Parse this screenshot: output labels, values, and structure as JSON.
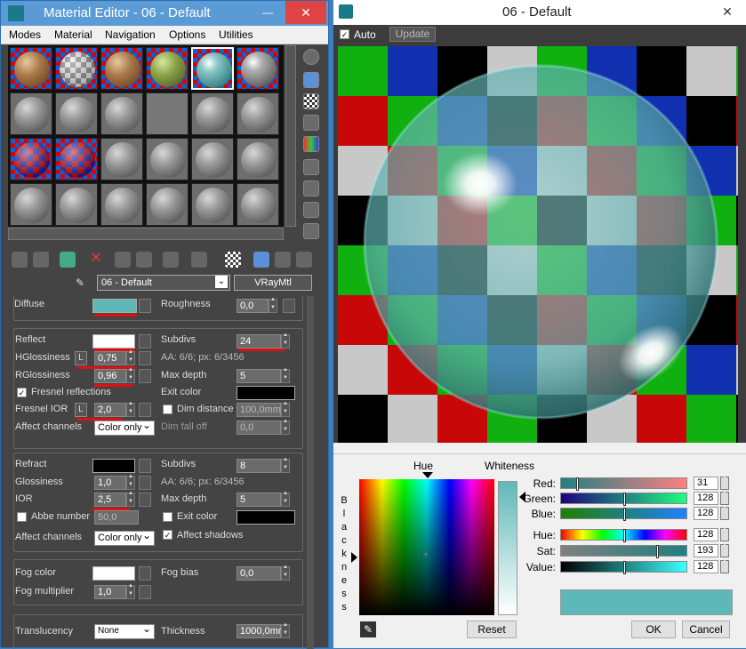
{
  "left_window": {
    "title": "Material Editor - 06 - Default",
    "minimize": "—",
    "close": "✕"
  },
  "menu": [
    "Modes",
    "Material",
    "Navigation",
    "Options",
    "Utilities"
  ],
  "material": {
    "name": "06 - Default",
    "type": "VRayMtl"
  },
  "params": {
    "diffuse_label": "Diffuse",
    "diffuse_color": "#5fb8b8",
    "roughness_label": "Roughness",
    "roughness_value": "0,0",
    "reflect_label": "Reflect",
    "reflect_color": "#ffffff",
    "subdivs_label": "Subdivs",
    "refl_subdivs": "24",
    "hgloss_label": "HGlossiness",
    "hgloss_lock": "L",
    "hgloss_value": "0,75",
    "refl_aa": "AA: 6/6; px: 6/3456",
    "rgloss_label": "RGlossiness",
    "rgloss_value": "0,96",
    "max_depth_label": "Max depth",
    "refl_max_depth": "5",
    "fresnel_label": "Fresnel reflections",
    "exit_color_label": "Exit color",
    "fresnel_ior_label": "Fresnel IOR",
    "fresnel_ior_lock": "L",
    "fresnel_ior_value": "2,0",
    "dim_distance_label": "Dim distance",
    "dim_distance_value": "100,0mm",
    "affect_channels_label": "Affect channels",
    "affect_channels_value": "Color only",
    "dim_falloff_label": "Dim fall off",
    "dim_falloff_value": "0,0",
    "refract_label": "Refract",
    "refract_color": "#000000",
    "refr_subdivs": "8",
    "glossiness_label": "Glossiness",
    "glossiness_value": "1,0",
    "refr_aa": "AA: 6/6; px: 6/3456",
    "ior_label": "IOR",
    "ior_value": "2,5",
    "refr_max_depth": "5",
    "abbe_label": "Abbe number",
    "abbe_value": "50,0",
    "refr_exit_label": "Exit color",
    "refr_affect_label": "Affect channels",
    "refr_affect_value": "Color only",
    "affect_shadows_label": "Affect shadows",
    "fog_color_label": "Fog color",
    "fog_color": "#ffffff",
    "fog_bias_label": "Fog bias",
    "fog_bias_value": "0,0",
    "fog_mult_label": "Fog multiplier",
    "fog_mult_value": "1,0",
    "translucency_label": "Translucency",
    "translucency_value": "None",
    "thickness_label": "Thickness",
    "thickness_value": "1000,0mm"
  },
  "right_window": {
    "title": "06 - Default",
    "close": "✕",
    "auto_label": "Auto",
    "update_label": "Update"
  },
  "color_picker": {
    "hue_label": "Hue",
    "whiteness_label": "Whiteness",
    "blackness_label": "Blackness",
    "red_label": "Red:",
    "red": "31",
    "green_label": "Green:",
    "green": "128",
    "blue_label": "Blue:",
    "blue": "128",
    "hue2_label": "Hue:",
    "hue": "128",
    "sat_label": "Sat:",
    "sat": "193",
    "value_label": "Value:",
    "value": "128",
    "current_color": "#5fb8b8",
    "reset_label": "Reset",
    "ok_label": "OK",
    "cancel_label": "Cancel"
  },
  "colors": {
    "title_blue": "#5b9bd5",
    "close_red": "#e04343",
    "panel_bg": "#444444"
  }
}
